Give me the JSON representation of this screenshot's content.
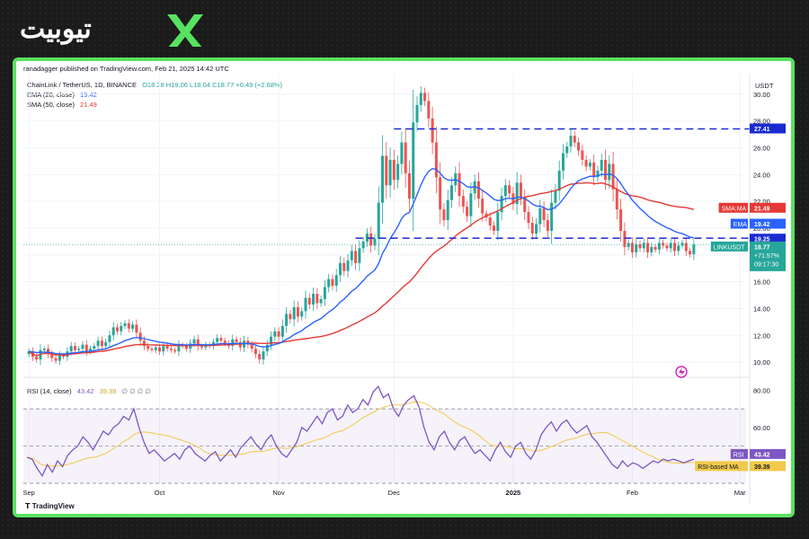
{
  "site": {
    "logo_text": "تیوبیت",
    "logo_mark": "X"
  },
  "publisher": "ranadagger published on TradingView.com, Feb 21, 2025 14:42 UTC",
  "legend": {
    "symbol": "ChainLink / TetherUS, 1D, BINANCE",
    "ohlc": "O18.28 H19.06 L18.04 C18.77 +0.49 (+2.68%)",
    "ema_label": "EMA (20, close)",
    "ema_value": "19.42",
    "sma_label": "SMA (50, close)",
    "sma_value": "21.49",
    "rsi_label": "RSI (14, close)",
    "rsi_value": "43.42",
    "rsi_ma_value": "39.39",
    "rsi_icons": "∅ ∅ ∅ ∅"
  },
  "price_axis": {
    "currency": "USDT",
    "ticks": [
      "30.00",
      "28.00",
      "26.00",
      "24.00",
      "22.00",
      "20.00",
      "18.00",
      "16.00",
      "14.00",
      "12.00",
      "10.00"
    ]
  },
  "rsi_axis": {
    "ticks": [
      "80.00",
      "60.00"
    ]
  },
  "time_axis": [
    "Sep",
    "Oct",
    "Nov",
    "Dec",
    "2025",
    "Feb",
    "Mar"
  ],
  "badges": {
    "level_top": "27.41",
    "sma_name": "SMA:MA",
    "sma_val": "21.49",
    "ema_name": "EMA",
    "ema_val": "19.42",
    "level_bottom": "19.25",
    "symbol_name": "LINKUSDT",
    "price": "18.77",
    "change": "+71.57%",
    "countdown": "09:17:30",
    "rsi_name": "RSI",
    "rsi_val": "43.42",
    "rsi_ma_name": "RSI-based MA",
    "rsi_ma_val": "39.39"
  },
  "footer_brand": "TradingView",
  "colors": {
    "up": "#26a69a",
    "down": "#ef5350",
    "ema": "#2962ff",
    "sma": "#e53935",
    "rsi": "#7e57c2",
    "rsi_ma": "#f2c94c",
    "frame": "#57e35f",
    "level": "#1a2bd1"
  },
  "chart_data": {
    "type": "candlestick",
    "title": "ChainLink / TetherUS, 1D, BINANCE",
    "ylim": [
      9,
      31
    ],
    "x_range": [
      "Aug 28, 2024",
      "Feb 21, 2025"
    ],
    "horizontal_levels": [
      27.41,
      19.25
    ],
    "ohlc_months": [
      {
        "month": "Sep",
        "close": [
          10.8,
          10.4,
          10.2,
          10.9,
          11.0,
          10.6,
          10.3,
          10.1,
          10.5,
          10.4,
          10.8,
          11.2,
          10.9,
          11.0,
          11.3,
          10.8,
          11.0,
          11.2,
          11.6,
          11.2,
          11.5,
          12.0,
          12.6,
          12.3,
          12.7,
          12.9,
          12.5,
          12.8,
          12.2,
          11.6
        ]
      },
      {
        "month": "Oct",
        "close": [
          11.2,
          11.0,
          10.9,
          11.1,
          10.8,
          11.2,
          11.0,
          10.9,
          10.8,
          11.3,
          11.2,
          11.0,
          11.4,
          11.7,
          11.2,
          11.1,
          11.3,
          11.2,
          11.5,
          11.8,
          11.6,
          11.4,
          11.2,
          11.7,
          11.5,
          11.1,
          11.6,
          11.3,
          11.0,
          10.6,
          10.2
        ]
      },
      {
        "month": "Nov",
        "close": [
          10.8,
          11.3,
          11.9,
          12.3,
          11.9,
          12.7,
          13.6,
          13.2,
          14.1,
          13.4,
          13.8,
          14.8,
          14.3,
          15.1,
          14.4,
          14.7,
          15.6,
          16.2,
          15.7,
          16.5,
          17.4,
          16.8,
          17.6,
          18.3,
          17.4,
          18.5,
          19.0,
          19.6,
          18.7,
          19.2
        ]
      },
      {
        "month": "Dec",
        "close": [
          21.9,
          25.4,
          23.2,
          25.1,
          23.6,
          24.8,
          26.4,
          24.1,
          22.2,
          27.9,
          29.2,
          30.1,
          29.5,
          28.2,
          26.4,
          23.8,
          21.4,
          20.6,
          22.1,
          23.2,
          24.1,
          22.4,
          21.6,
          20.9,
          22.6,
          23.5,
          22.2,
          21.1,
          20.8,
          20.2,
          19.8
        ]
      },
      {
        "month": "Jan",
        "close": [
          21.2,
          22.4,
          23.2,
          22.6,
          21.8,
          23.4,
          22.3,
          21.2,
          20.4,
          19.6,
          20.3,
          21.5,
          20.6,
          19.8,
          21.9,
          22.8,
          24.3,
          25.6,
          26.1,
          26.9,
          26.4,
          25.8,
          25.1,
          24.6,
          24.9,
          23.8,
          24.3,
          25.1,
          23.6,
          24.8,
          22.9
        ]
      },
      {
        "month": "Feb",
        "close": [
          21.4,
          19.8,
          18.6,
          18.9,
          18.2,
          18.8,
          18.5,
          18.9,
          18.2,
          18.6,
          18.4,
          18.9,
          18.7,
          18.5,
          18.9,
          18.3,
          18.7,
          18.9,
          18.3,
          18.05,
          18.77
        ]
      }
    ],
    "series": [
      {
        "name": "EMA (20, close)",
        "last": 19.42
      },
      {
        "name": "SMA (50, close)",
        "last": 21.49
      }
    ],
    "rsi": {
      "name": "RSI (14, close)",
      "last": 43.42,
      "ma_name": "RSI-based MA",
      "ma_last": 39.39,
      "ylim": [
        30,
        85
      ],
      "values": [
        44,
        43,
        38,
        34,
        40,
        36,
        42,
        39,
        45,
        48,
        50,
        55,
        52,
        48,
        53,
        58,
        56,
        60,
        62,
        66,
        64,
        70,
        60,
        52,
        46,
        48,
        45,
        42,
        44,
        46,
        43,
        48,
        50,
        46,
        44,
        42,
        45,
        47,
        42,
        45,
        48,
        44,
        49,
        52,
        55,
        51,
        48,
        53,
        56,
        50,
        46,
        44,
        48,
        52,
        60,
        58,
        62,
        66,
        62,
        68,
        70,
        64,
        66,
        72,
        68,
        70,
        75,
        72,
        79,
        82,
        76,
        78,
        70,
        66,
        72,
        75,
        77,
        71,
        60,
        52,
        48,
        55,
        58,
        52,
        48,
        53,
        55,
        50,
        46,
        48,
        45,
        42,
        48,
        52,
        47,
        44,
        50,
        52,
        46,
        43,
        48,
        56,
        60,
        63,
        58,
        62,
        64,
        60,
        57,
        59,
        61,
        55,
        52,
        48,
        44,
        40,
        38,
        42,
        39,
        41,
        40,
        38,
        40,
        42,
        41,
        43,
        42,
        43,
        42,
        41,
        42,
        43
      ]
    }
  }
}
